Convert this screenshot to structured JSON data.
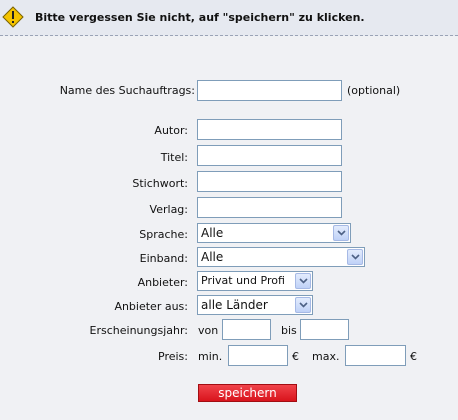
{
  "notice": {
    "icon": "warning-icon",
    "text": "Bitte vergessen Sie nicht, auf \"speichern\" zu klicken."
  },
  "form": {
    "name_label": "Name des Suchauftrags:",
    "name_value": "",
    "optional_hint": "(optional)",
    "author_label": "Autor:",
    "author_value": "",
    "title_label": "Titel:",
    "title_value": "",
    "keyword_label": "Stichwort:",
    "keyword_value": "",
    "publisher_label": "Verlag:",
    "publisher_value": "",
    "language_label": "Sprache:",
    "language_selected": "Alle",
    "binding_label": "Einband:",
    "binding_selected": "Alle",
    "provider_label": "Anbieter:",
    "provider_selected": "Privat und Profi",
    "provider_from_label": "Anbieter aus:",
    "provider_from_selected": "alle Länder",
    "year_label": "Erscheinungsjahr:",
    "year_from_label": "von",
    "year_from_value": "",
    "year_to_label": "bis",
    "year_to_value": "",
    "price_label": "Preis:",
    "price_min_label": "min.",
    "price_min_value": "",
    "price_currency": "€",
    "price_max_label": "max.",
    "price_max_value": "",
    "save_button": "speichern"
  },
  "colors": {
    "notice_bg": "#e6e9f0",
    "page_bg": "#f0f1f4",
    "input_border": "#7f9db9",
    "button_red": "#d9141c",
    "warning_yellow": "#f5c400"
  }
}
